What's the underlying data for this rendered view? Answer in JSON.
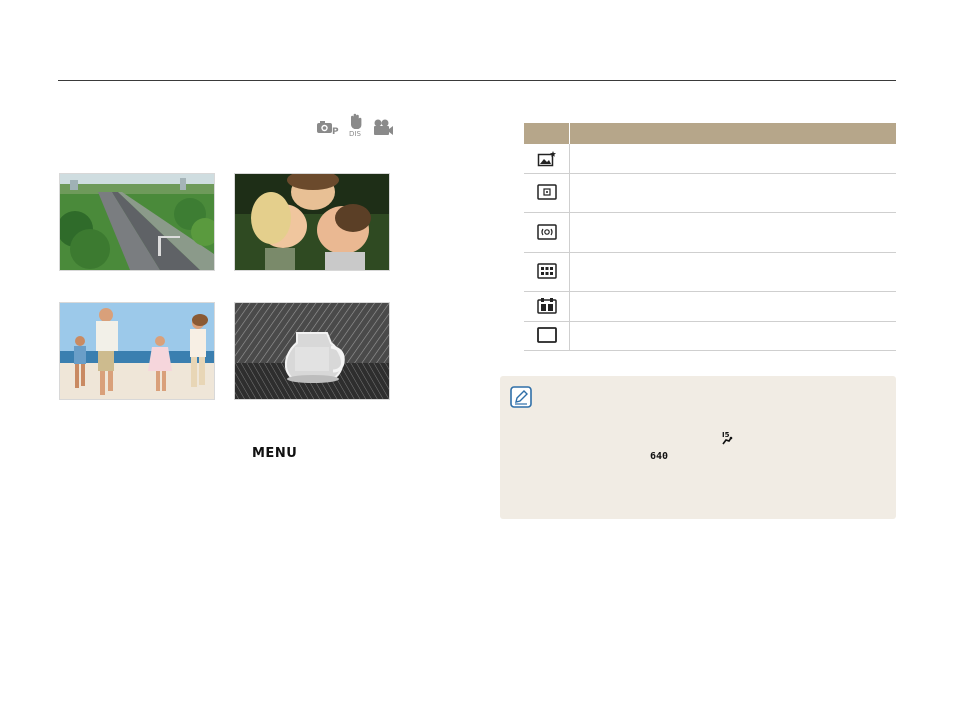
{
  "header": {
    "mode_icons": [
      "camera-program-icon",
      "dual-is-icon",
      "movie-icon"
    ]
  },
  "photos": [
    {
      "name": "photo-highway",
      "subject": "highway"
    },
    {
      "name": "photo-couple",
      "subject": "couple"
    },
    {
      "name": "photo-family",
      "subject": "family"
    },
    {
      "name": "photo-sketch",
      "subject": "sketch"
    }
  ],
  "menu_key_label": "MENU",
  "options_table": {
    "header_color": "#b6a68a",
    "rows": [
      {
        "icon": "smart-face-af-icon"
      },
      {
        "icon": "spot-af-icon"
      },
      {
        "icon": "center-af-icon"
      },
      {
        "icon": "multi-af-icon"
      },
      {
        "icon": "tracking-af-icon"
      },
      {
        "icon": "wide-frame-icon"
      }
    ]
  },
  "note": {
    "background": "#f1ece4",
    "icon": "note-pencil-icon",
    "glyphs": [
      "sport-scene-icon",
      "resolution-640-icon"
    ]
  }
}
